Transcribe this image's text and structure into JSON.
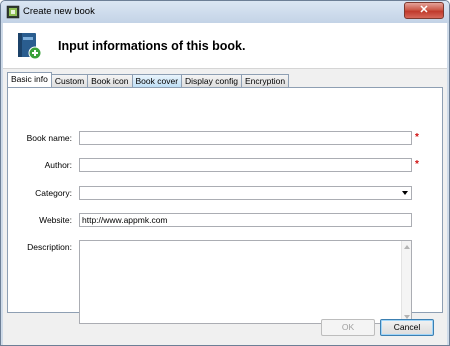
{
  "window": {
    "title": "Create new book",
    "close_glyph": "✕"
  },
  "header": {
    "title": "Input informations of this book."
  },
  "tabs": [
    {
      "label": "Basic info",
      "active": true
    },
    {
      "label": "Custom"
    },
    {
      "label": "Book icon"
    },
    {
      "label": "Book cover",
      "hover": true
    },
    {
      "label": "Display config"
    },
    {
      "label": "Encryption"
    }
  ],
  "form": {
    "book_name": {
      "label": "Book name:",
      "value": "",
      "required": true
    },
    "author": {
      "label": "Author:",
      "value": "",
      "required": true
    },
    "category": {
      "label": "Category:",
      "value": ""
    },
    "website": {
      "label": "Website:",
      "value": "http://www.appmk.com"
    },
    "description": {
      "label": "Description:",
      "value": ""
    },
    "required_mark": "*"
  },
  "buttons": {
    "ok": "OK",
    "cancel": "Cancel"
  },
  "icons": {
    "app": "app-book-icon",
    "book": "book-add-icon"
  },
  "colors": {
    "required": "#d01010",
    "close": "#c0392b",
    "focus": "#3c7fb1"
  }
}
